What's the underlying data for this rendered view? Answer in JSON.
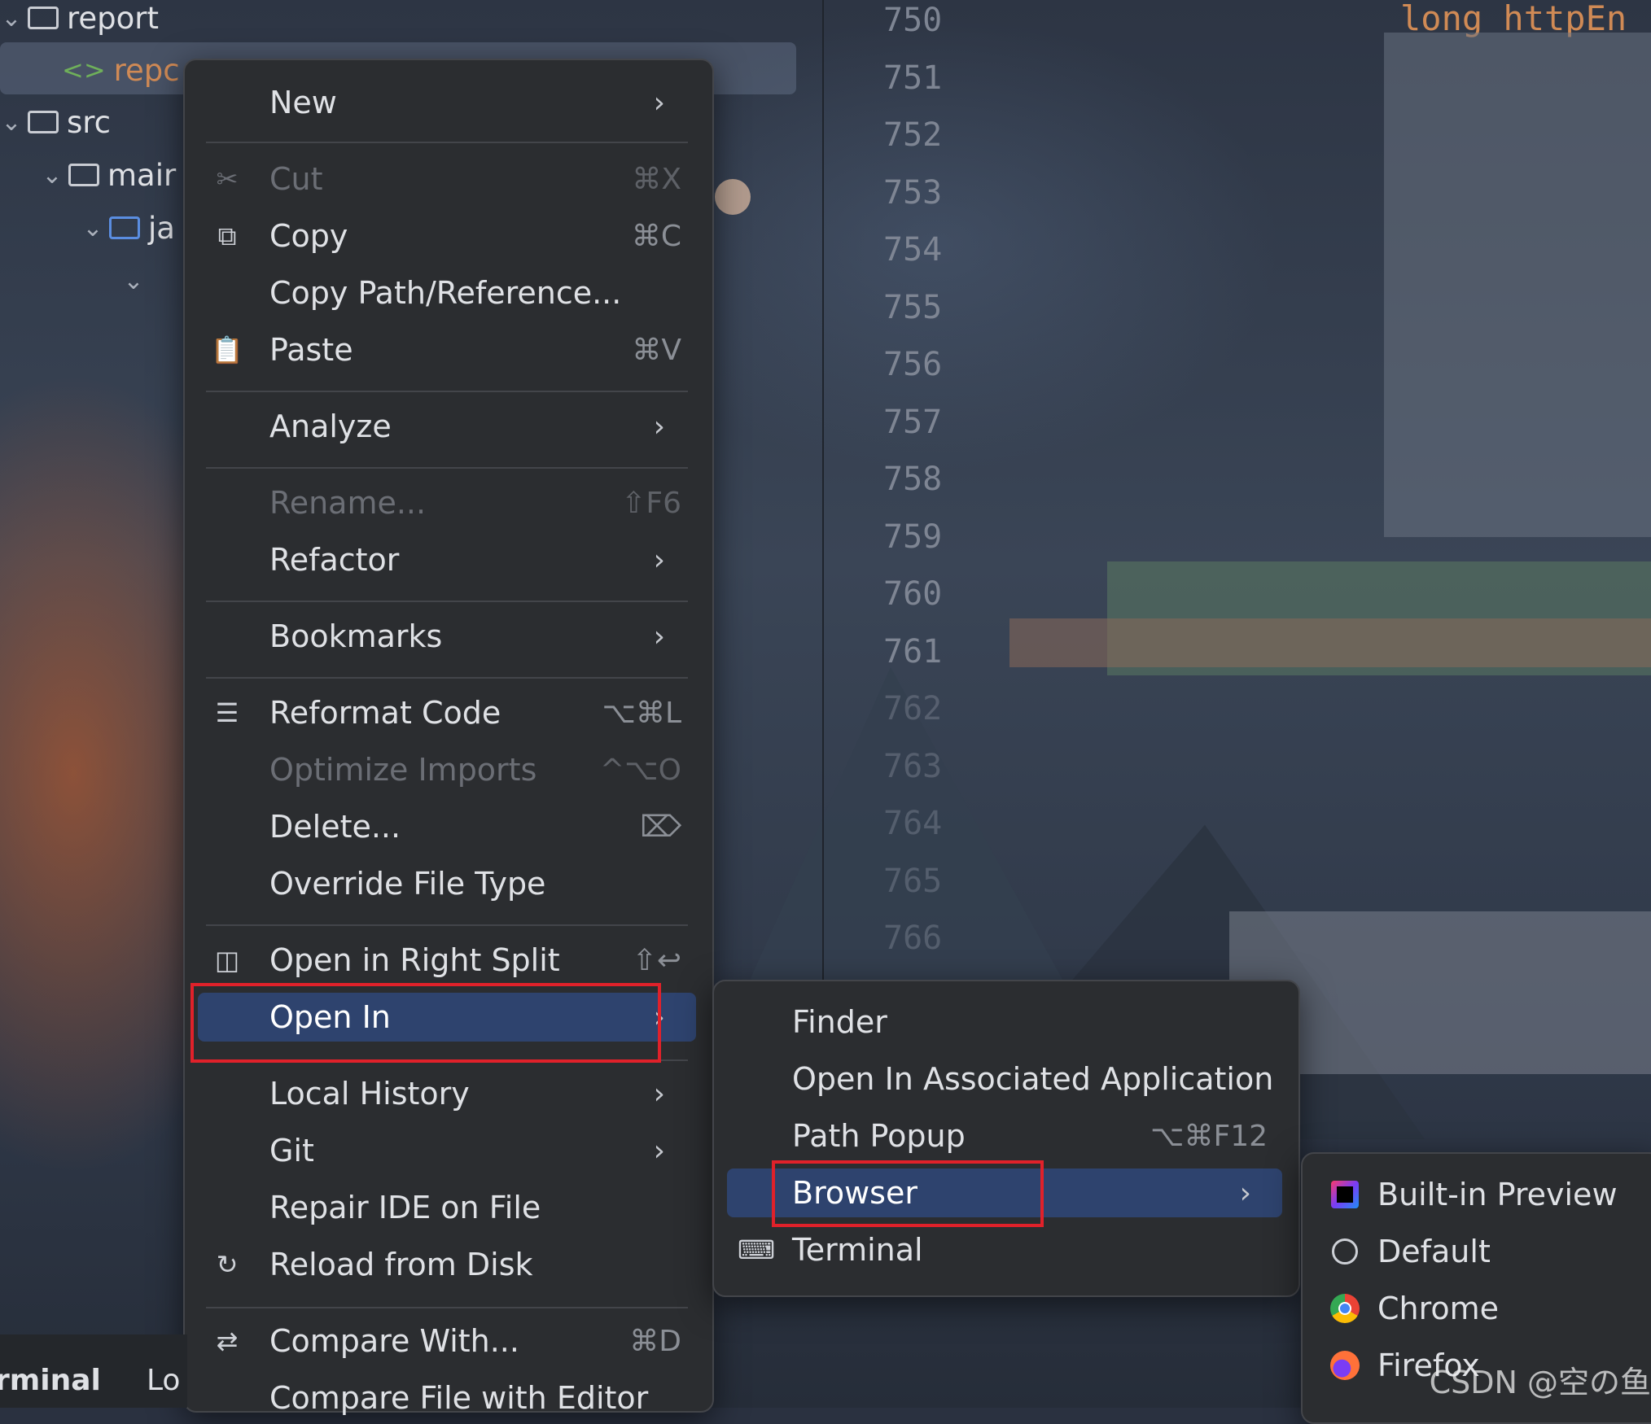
{
  "project_tree": {
    "items": [
      {
        "label": "report",
        "type": "folder"
      },
      {
        "label": "repc",
        "type": "file"
      },
      {
        "label": "src",
        "type": "folder"
      },
      {
        "label": "mair",
        "type": "folder"
      },
      {
        "label": "ja",
        "type": "folder"
      }
    ]
  },
  "editor": {
    "line_numbers": [
      "750",
      "751",
      "752",
      "753",
      "754",
      "755",
      "756",
      "757",
      "758",
      "759",
      "760",
      "761",
      "762",
      "763",
      "764",
      "765",
      "766"
    ],
    "visible_code": "long httpEn"
  },
  "context_menu": {
    "items": [
      {
        "label": "New",
        "shortcut": "",
        "submenu": true
      },
      {
        "label": "Cut",
        "shortcut": "⌘X",
        "disabled": true
      },
      {
        "label": "Copy",
        "shortcut": "⌘C"
      },
      {
        "label": "Copy Path/Reference...",
        "shortcut": ""
      },
      {
        "label": "Paste",
        "shortcut": "⌘V"
      },
      {
        "label": "Analyze",
        "submenu": true
      },
      {
        "label": "Rename...",
        "shortcut": "⇧F6",
        "disabled": true
      },
      {
        "label": "Refactor",
        "submenu": true
      },
      {
        "label": "Bookmarks",
        "submenu": true
      },
      {
        "label": "Reformat Code",
        "shortcut": "⌥⌘L"
      },
      {
        "label": "Optimize Imports",
        "shortcut": "^⌥O",
        "disabled": true
      },
      {
        "label": "Delete...",
        "shortcut": "⌦"
      },
      {
        "label": "Override File Type",
        "shortcut": ""
      },
      {
        "label": "Open in Right Split",
        "shortcut": "⇧↩"
      },
      {
        "label": "Open In",
        "submenu": true,
        "highlighted": true
      },
      {
        "label": "Local History",
        "submenu": true
      },
      {
        "label": "Git",
        "submenu": true
      },
      {
        "label": "Repair IDE on File",
        "shortcut": ""
      },
      {
        "label": "Reload from Disk",
        "shortcut": ""
      },
      {
        "label": "Compare With...",
        "shortcut": "⌘D"
      },
      {
        "label": "Compare File with Editor",
        "shortcut": ""
      }
    ]
  },
  "open_in_submenu": {
    "items": [
      {
        "label": "Finder"
      },
      {
        "label": "Open In Associated Application"
      },
      {
        "label": "Path Popup",
        "shortcut": "⌥⌘F12"
      },
      {
        "label": "Browser",
        "submenu": true,
        "highlighted": true
      },
      {
        "label": "Terminal"
      }
    ]
  },
  "browser_submenu": {
    "items": [
      {
        "label": "Built-in Preview",
        "icon": "intellij-icon"
      },
      {
        "label": "Default",
        "icon": "globe-icon"
      },
      {
        "label": "Chrome",
        "icon": "chrome-icon"
      },
      {
        "label": "Firefox",
        "icon": "firefox-icon"
      }
    ]
  },
  "tool_windows": {
    "terminal": "rminal",
    "log": "Lo"
  },
  "watermark": "CSDN @空の鱼",
  "colors": {
    "highlight": "#2e436e",
    "annotation_red": "#e0212a",
    "menu_bg": "#2b2d30"
  }
}
